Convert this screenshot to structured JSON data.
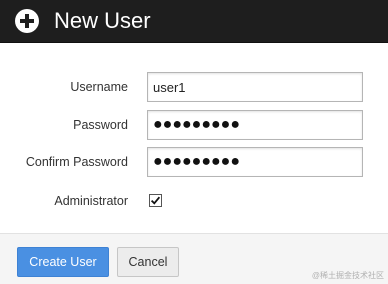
{
  "dialog": {
    "title": "New User",
    "title_icon": "plus-circle-icon"
  },
  "form": {
    "username": {
      "label": "Username",
      "value": "user1"
    },
    "password": {
      "label": "Password",
      "value": "●●●●●●●●●"
    },
    "confirm_password": {
      "label": "Confirm Password",
      "value": "●●●●●●●●●"
    },
    "administrator": {
      "label": "Administrator",
      "checked": true
    }
  },
  "footer": {
    "create_label": "Create User",
    "cancel_label": "Cancel"
  },
  "watermark": "@稀土掘金技术社区",
  "colors": {
    "titlebar": "#1e1e1e",
    "primary_button": "#4a90e2",
    "footer": "#f5f5f5"
  }
}
